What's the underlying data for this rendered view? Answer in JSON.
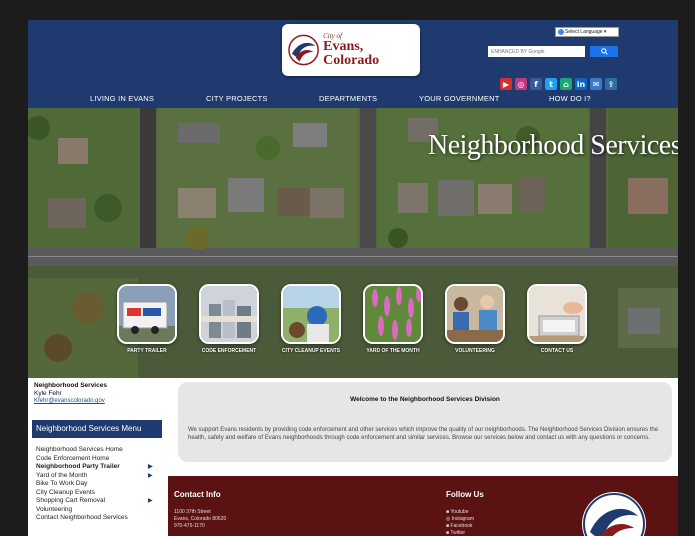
{
  "header": {
    "logo_small": "City of",
    "logo_big": "Evans, Colorado",
    "language_label": "Select Language",
    "search_placeholder": "ENHANCED BY Google",
    "social": [
      {
        "name": "youtube",
        "glyph": "▶",
        "color": "#d32f2f"
      },
      {
        "name": "instagram",
        "glyph": "◎",
        "color": "#c13584"
      },
      {
        "name": "facebook",
        "glyph": "f",
        "color": "#3b5998"
      },
      {
        "name": "twitter",
        "glyph": "t",
        "color": "#1da1f2"
      },
      {
        "name": "nextdoor",
        "glyph": "⌂",
        "color": "#19a974"
      },
      {
        "name": "linkedin",
        "glyph": "in",
        "color": "#0a66c2"
      },
      {
        "name": "email",
        "glyph": "✉",
        "color": "#3a78c8"
      },
      {
        "name": "share",
        "glyph": "⇪",
        "color": "#2e6da4"
      }
    ]
  },
  "nav": [
    "LIVING IN EVANS",
    "CITY PROJECTS",
    "DEPARTMENTS",
    "YOUR GOVERNMENT",
    "HOW DO I?"
  ],
  "hero": {
    "title": "Neighborhood Services",
    "tiles": [
      {
        "label": "PARTY TRAILER"
      },
      {
        "label": "CODE ENFORCEMENT"
      },
      {
        "label": "CITY CLEANUP EVENTS"
      },
      {
        "label": "YARD OF THE MONTH"
      },
      {
        "label": "VOLUNTEERING"
      },
      {
        "label": "CONTACT US"
      }
    ]
  },
  "sidebar": {
    "title": "Neighborhood Services",
    "name": "Kyle Fehr",
    "email": "Kfehr@evanscolorado.gov",
    "menu_heading": "Neighborhood Services Menu",
    "items": [
      {
        "label": "Neighborhood Services Home",
        "bold": false,
        "arrow": false
      },
      {
        "label": "Code Enforcement Home",
        "bold": false,
        "arrow": false
      },
      {
        "label": "Neighborhood Party Trailer",
        "bold": true,
        "arrow": true
      },
      {
        "label": "Yard of the Month",
        "bold": false,
        "arrow": true
      },
      {
        "label": "Bike To Work Day",
        "bold": false,
        "arrow": false
      },
      {
        "label": "City Cleanup Events",
        "bold": false,
        "arrow": false
      },
      {
        "label": "Shopping Cart Removal",
        "bold": false,
        "arrow": true
      },
      {
        "label": "Volunteering",
        "bold": false,
        "arrow": false
      },
      {
        "label": "Contact Neighborhood Services",
        "bold": false,
        "arrow": false
      }
    ]
  },
  "welcome": {
    "title": "Welcome to the Neighborhood Services Division",
    "body": "We support Evans residents by providing code enforcement and other services which improve the quality of our neighborhoods. The Neighborhood Services Division ensures the health, safety and welfare of Evans neighborhoods through code enforcement and similar services. Browse our services below and contact us with any questions or concerns."
  },
  "footer": {
    "contact_heading": "Contact Info",
    "address": [
      "1100 37th Street",
      "Evans, Colorado 80620",
      "970-475-1170"
    ],
    "follow_heading": "Follow Us",
    "follow_links": [
      "Youtube",
      "Instagram",
      "Facebook",
      "Twitter"
    ]
  }
}
